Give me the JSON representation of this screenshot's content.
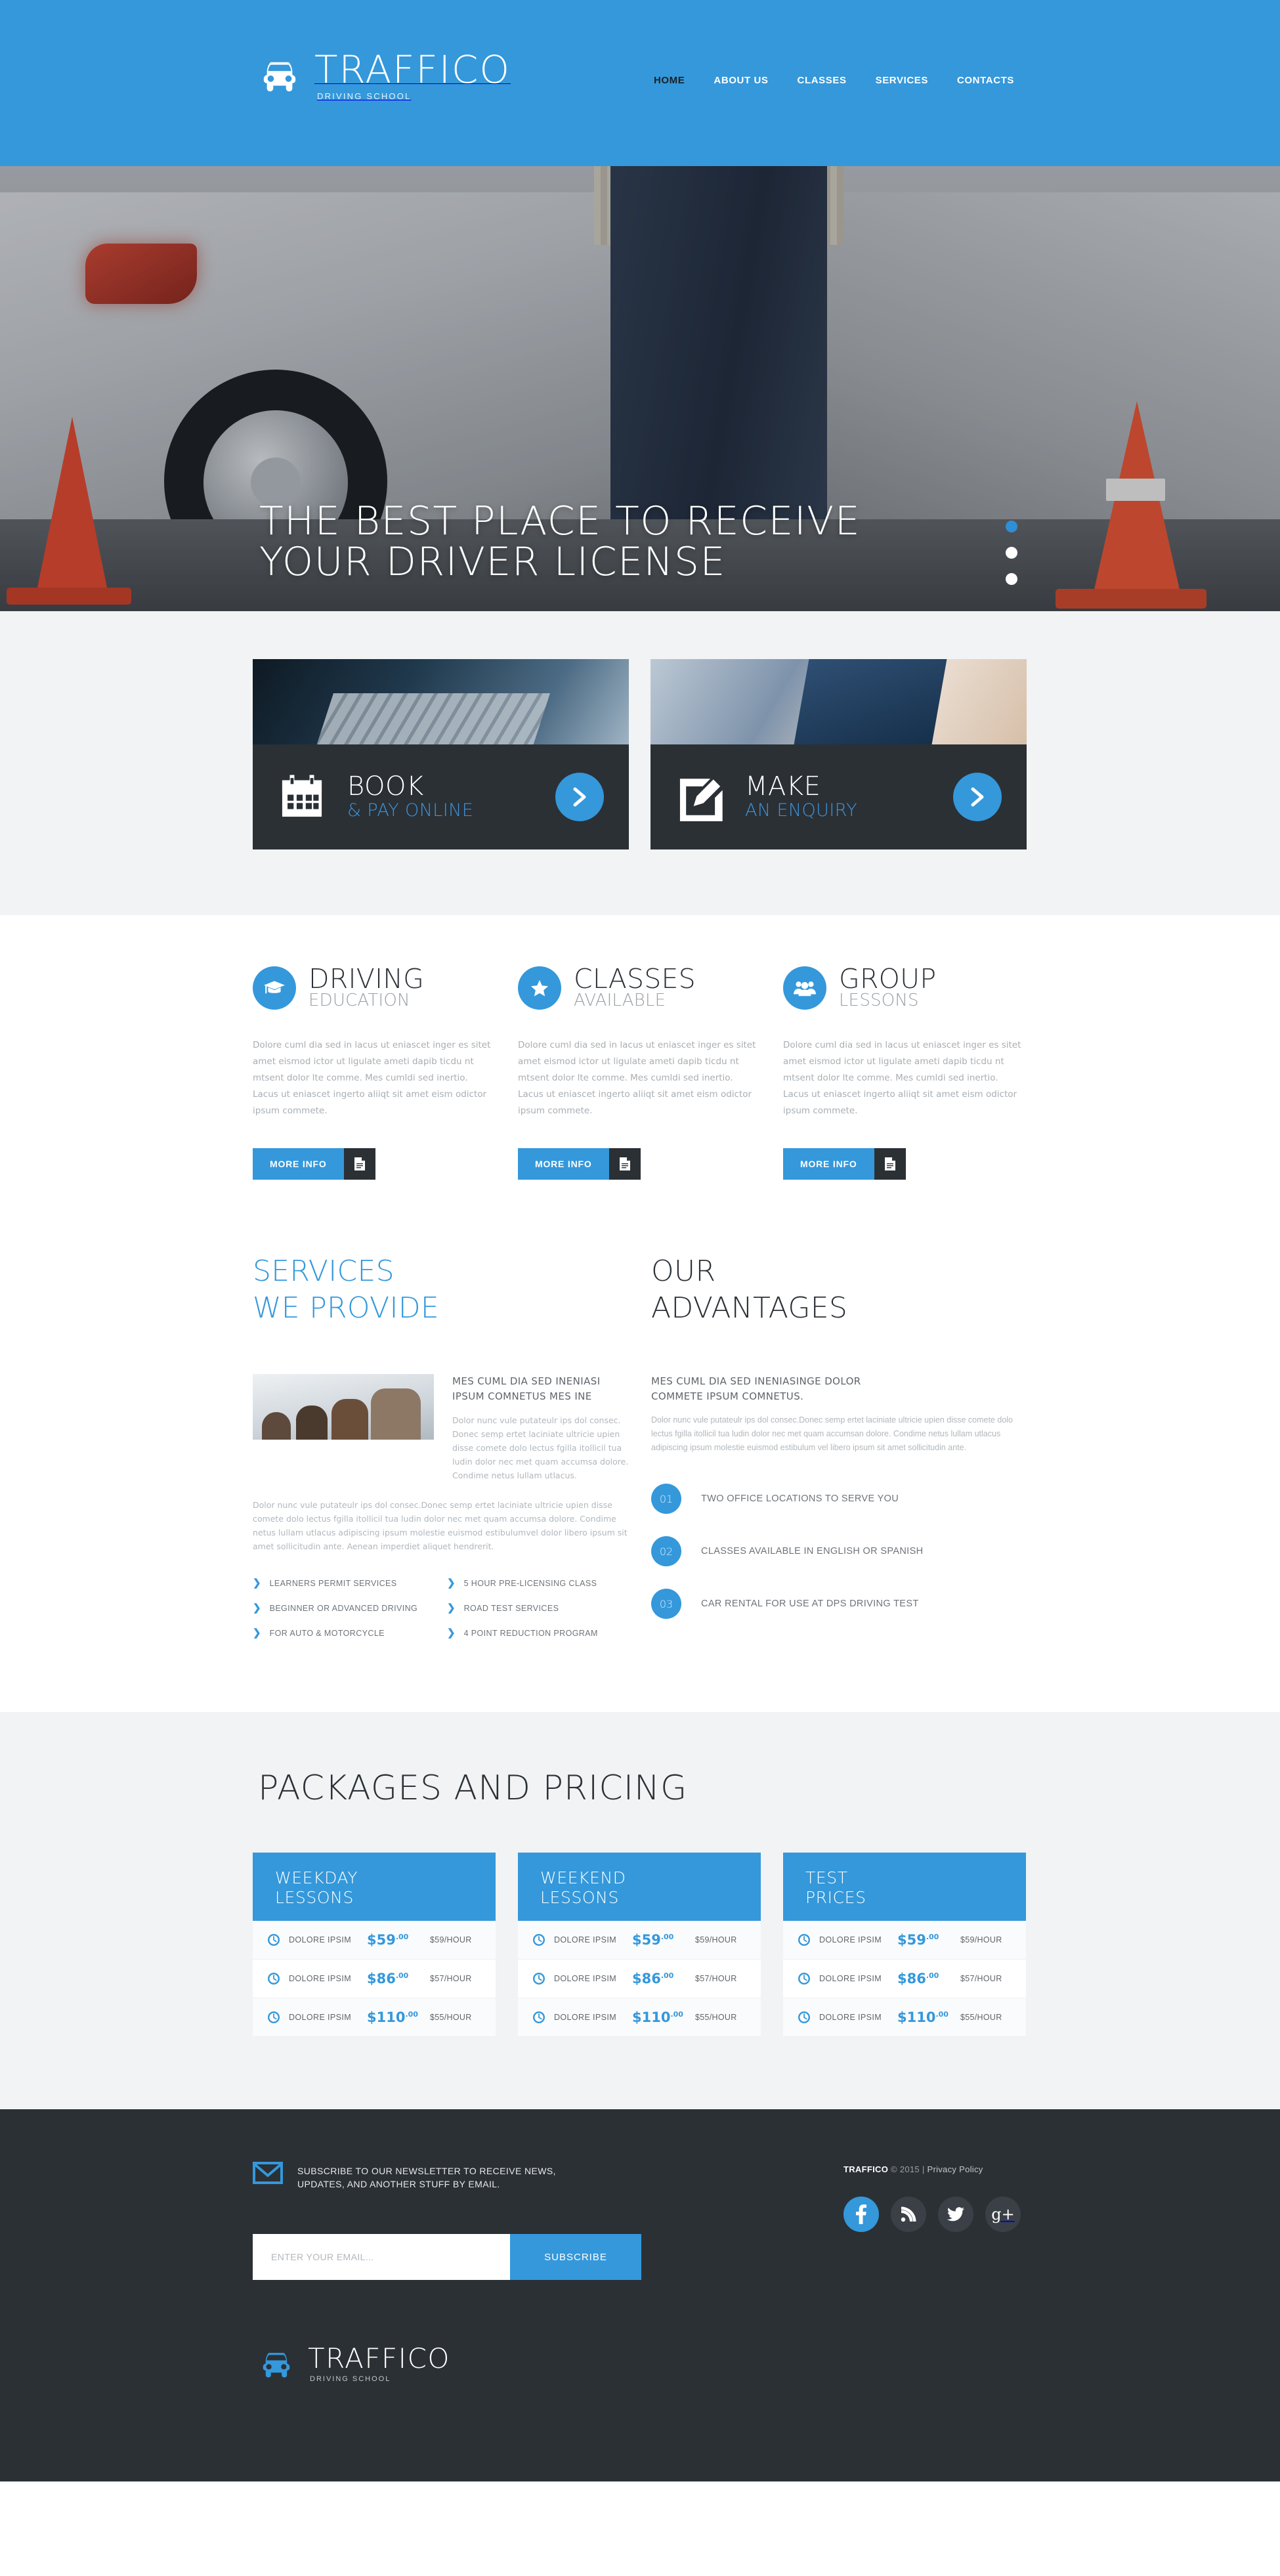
{
  "header": {
    "brand": "TRAFFICO",
    "tagline": "DRIVING SCHOOL",
    "nav": [
      {
        "label": "HOME",
        "active": true
      },
      {
        "label": "ABOUT US",
        "active": false
      },
      {
        "label": "CLASSES",
        "active": false
      },
      {
        "label": "SERVICES",
        "active": false
      },
      {
        "label": "CONTACTS",
        "active": false
      }
    ],
    "accent_color": "#3498db"
  },
  "hero": {
    "line1": "THE BEST PLACE TO RECEIVE",
    "line2": "YOUR DRIVER LICENSE",
    "slides": 3,
    "active_slide": 1
  },
  "cta": [
    {
      "main": "BOOK",
      "sub": "& PAY ONLINE",
      "icon": "calendar-icon"
    },
    {
      "main": "MAKE",
      "sub": "AN ENQUIRY",
      "icon": "pencil-square-icon"
    }
  ],
  "features": [
    {
      "title": "DRIVING",
      "subtitle": "EDUCATION",
      "icon": "graduation-cap-icon",
      "body": "Dolore cuml dia sed in lacus ut eniascet inger es sitet amet eismod ictor ut ligulate ameti dapib ticdu nt mtsent dolor lte comme. Mes cumldi sed inertio. Lacus ut eniascet ingerto aliiqt sit amet eism odictor ipsum commete.",
      "button": "MORE INFO"
    },
    {
      "title": "CLASSES",
      "subtitle": "AVAILABLE",
      "icon": "star-icon",
      "body": "Dolore cuml dia sed in lacus ut eniascet inger es sitet amet eismod ictor ut ligulate ameti dapib ticdu nt mtsent dolor lte comme. Mes cumldi sed inertio. Lacus ut eniascet ingerto aliiqt sit amet eism odictor ipsum commete.",
      "button": "MORE INFO"
    },
    {
      "title": "GROUP",
      "subtitle": "LESSONS",
      "icon": "users-group-icon",
      "body": "Dolore cuml dia sed in lacus ut eniascet inger es sitet amet eismod ictor ut ligulate ameti dapib ticdu nt mtsent dolor lte comme. Mes cumldi sed inertio. Lacus ut eniascet ingerto aliiqt sit amet eism odictor ipsum commete.",
      "button": "MORE INFO"
    }
  ],
  "services": {
    "heading_line1": "SERVICES",
    "heading_line2": "WE PROVIDE",
    "subheading_line1": "MES CUML DIA SED INENIASI",
    "subheading_line2": "IPSUM COMNETUS MES INE",
    "intro": "Dolor nunc vule putateulr ips dol consec. Donec semp ertet laciniate ultricie upien disse comete dolo lectus fgilla itollicil tua ludin dolor nec met quam accumsa dolore. Condime netus lullam utlacus.",
    "body": "Dolor nunc vule putateulr ips dol consec.Donec semp ertet laciniate ultricie upien disse comete dolo lectus fgilla itollicil tua ludin dolor nec met quam accumsa dolore. Condime netus lullam utlacus adipiscing ipsum molestie euismod estibulumvel dolor libero ipsum sit amet sollicitudin ante. Aenean imperdiet aliquet hendrerit.",
    "links_col1": [
      "LEARNERS PERMIT SERVICES",
      "BEGINNER OR ADVANCED DRIVING",
      "FOR AUTO & MOTORCYCLE"
    ],
    "links_col2": [
      "5 HOUR PRE-LICENSING CLASS",
      "ROAD TEST SERVICES",
      "4 POINT REDUCTION PROGRAM"
    ]
  },
  "advantages": {
    "heading_line1": "OUR",
    "heading_line2": "ADVANTAGES",
    "subheading_line1": "MES CUML DIA SED INENIASINGE DOLOR",
    "subheading_line2": "COMMETE IPSUM COMNETUS.",
    "body": "Dolor nunc vule putateulr ips dol consec.Donec semp ertet laciniate ultricie upien disse comete dolo lectus fgilla itollicil tua ludin dolor nec met quam accumsan dolore. Condime netus lullam utlacus adipiscing ipsum molestie euismod estibulum vel libero ipsum sit amet sollicitudin ante.",
    "items": [
      {
        "num": "01",
        "text": "TWO OFFICE LOCATIONS TO SERVE YOU"
      },
      {
        "num": "02",
        "text": "CLASSES AVAILABLE IN ENGLISH OR SPANISH"
      },
      {
        "num": "03",
        "text": "CAR RENTAL FOR USE AT DPS DRIVING TEST"
      }
    ]
  },
  "pricing": {
    "title": "PACKAGES AND PRICING",
    "cards": [
      {
        "title_line1": "WEEKDAY",
        "title_line2": "LESSONS",
        "rows": [
          {
            "name": "DOLORE IPSIM",
            "amount": "$59",
            "cents": ".00",
            "rate": "$59/HOUR"
          },
          {
            "name": "DOLORE IPSIM",
            "amount": "$86",
            "cents": ".00",
            "rate": "$57/HOUR"
          },
          {
            "name": "DOLORE IPSIM",
            "amount": "$110",
            "cents": ".00",
            "rate": "$55/HOUR"
          }
        ]
      },
      {
        "title_line1": "WEEKEND",
        "title_line2": "LESSONS",
        "rows": [
          {
            "name": "DOLORE IPSIM",
            "amount": "$59",
            "cents": ".00",
            "rate": "$59/HOUR"
          },
          {
            "name": "DOLORE IPSIM",
            "amount": "$86",
            "cents": ".00",
            "rate": "$57/HOUR"
          },
          {
            "name": "DOLORE IPSIM",
            "amount": "$110",
            "cents": ".00",
            "rate": "$55/HOUR"
          }
        ]
      },
      {
        "title_line1": "TEST",
        "title_line2": "PRICES",
        "rows": [
          {
            "name": "DOLORE IPSIM",
            "amount": "$59",
            "cents": ".00",
            "rate": "$59/HOUR"
          },
          {
            "name": "DOLORE IPSIM",
            "amount": "$86",
            "cents": ".00",
            "rate": "$57/HOUR"
          },
          {
            "name": "DOLORE IPSIM",
            "amount": "$110",
            "cents": ".00",
            "rate": "$55/HOUR"
          }
        ]
      }
    ]
  },
  "footer": {
    "newsletter_line1": "SUBSCRIBE TO OUR NEWSLETTER TO RECEIVE NEWS,",
    "newsletter_line2": "UPDATES, AND ANOTHER STUFF BY EMAIL.",
    "email_placeholder": "ENTER YOUR EMAIL...",
    "email_value": "",
    "subscribe_label": "SUBSCRIBE",
    "copyright_brand": "TRAFFICO",
    "copyright_rest": "© 2015  |",
    "privacy_label": "Privacy Policy",
    "socials": [
      {
        "name": "facebook-icon",
        "glyph": "f",
        "active": true
      },
      {
        "name": "rss-icon",
        "glyph": "",
        "active": false
      },
      {
        "name": "twitter-icon",
        "glyph": "",
        "active": false
      },
      {
        "name": "google-plus-icon",
        "glyph": "g+",
        "active": false
      }
    ],
    "brand": "TRAFFICO",
    "tagline": "DRIVING SCHOOL"
  }
}
